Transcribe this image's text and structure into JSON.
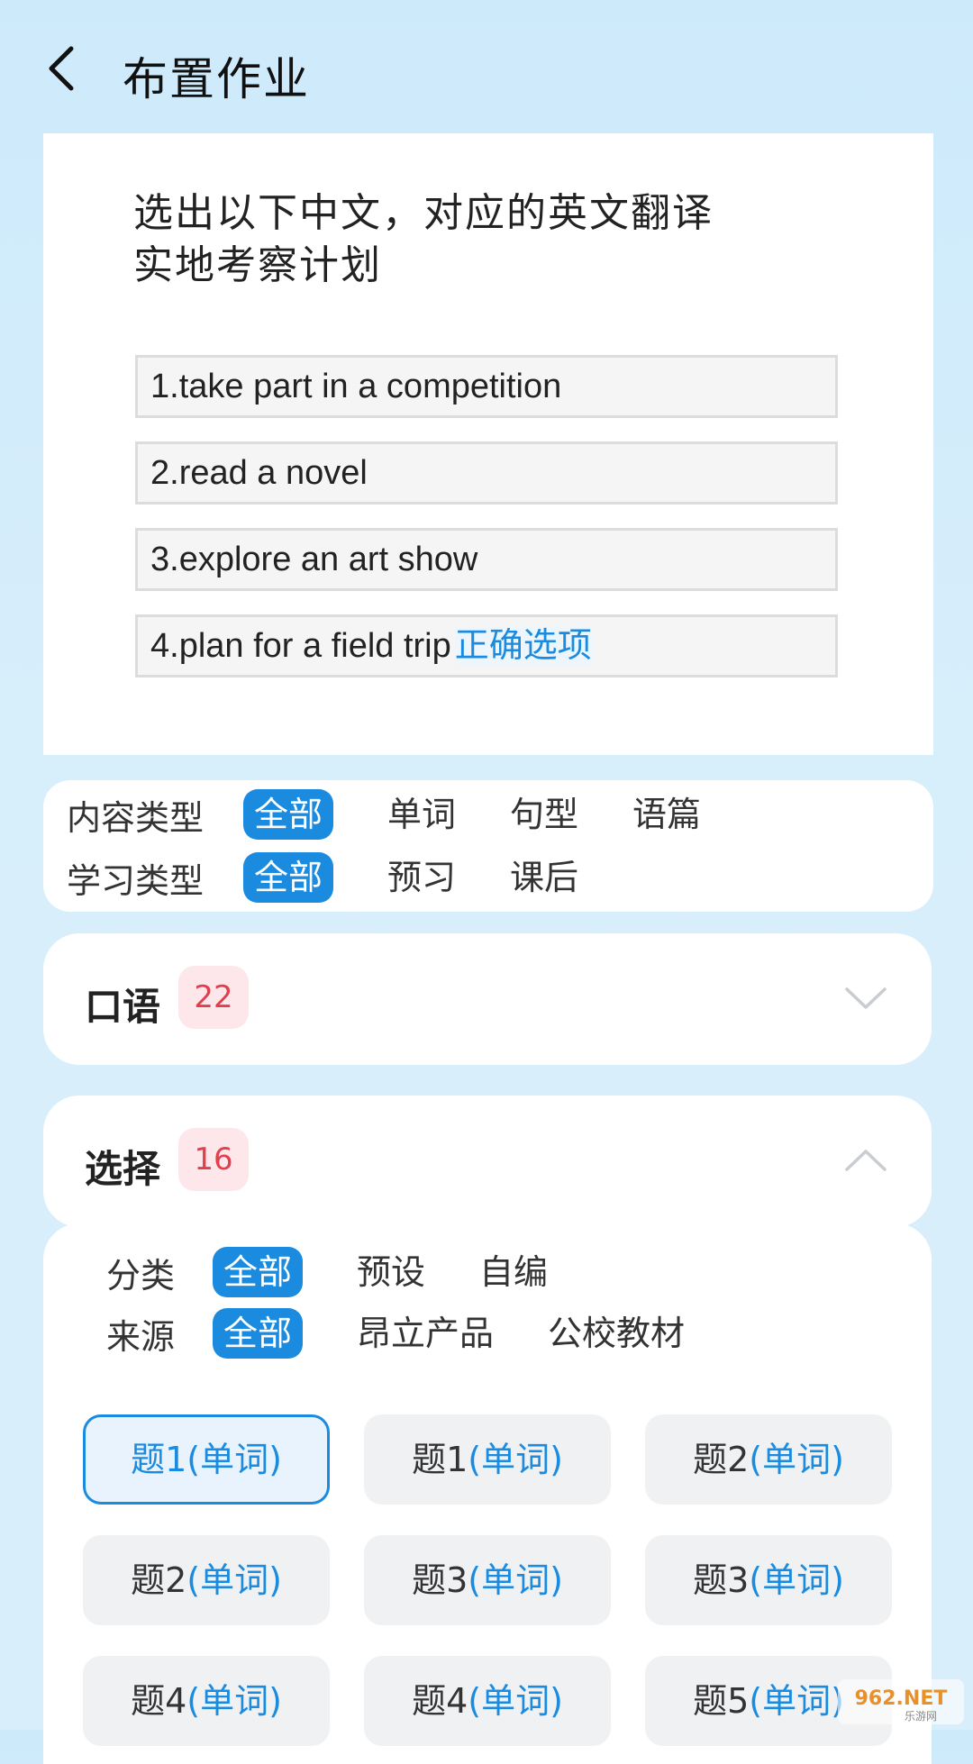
{
  "header": {
    "title": "布置作业"
  },
  "question": {
    "prompt_line1": "选出以下中文，对应的英文翻译",
    "prompt_line2": "实地考察计划",
    "options": [
      {
        "text": "1.take part in a competition",
        "tag": ""
      },
      {
        "text": "2.read a novel",
        "tag": ""
      },
      {
        "text": "3.explore an art show",
        "tag": ""
      },
      {
        "text": "4.plan for a field trip",
        "tag": "正确选项"
      }
    ]
  },
  "filters": {
    "content_label": "内容类型",
    "content_options": [
      "全部",
      "单词",
      "句型",
      "语篇"
    ],
    "study_label": "学习类型",
    "study_options": [
      "全部",
      "预习",
      "课后"
    ]
  },
  "sections": {
    "oral": {
      "title": "口语",
      "count": "22"
    },
    "choice": {
      "title": "选择",
      "count": "16"
    }
  },
  "choice_filters": {
    "category_label": "分类",
    "category_options": [
      "全部",
      "预设",
      "自编"
    ],
    "source_label": "来源",
    "source_options": [
      "全部",
      "昂立产品",
      "公校教材"
    ]
  },
  "questions": [
    {
      "label": "题1",
      "type": "(单词)"
    },
    {
      "label": "题1",
      "type": "(单词)"
    },
    {
      "label": "题2",
      "type": "(单词)"
    },
    {
      "label": "题2",
      "type": "(单词)"
    },
    {
      "label": "题3",
      "type": "(单词)"
    },
    {
      "label": "题3",
      "type": "(单词)"
    },
    {
      "label": "题4",
      "type": "(单词)"
    },
    {
      "label": "题4",
      "type": "(单词)"
    },
    {
      "label": "题5",
      "type": "(单词)"
    }
  ],
  "watermark": {
    "text": "962.NET",
    "sub": "乐游网"
  },
  "colors": {
    "accent": "#1b8be0",
    "badge_bg": "#fde7ea",
    "badge_text": "#e0404e"
  }
}
